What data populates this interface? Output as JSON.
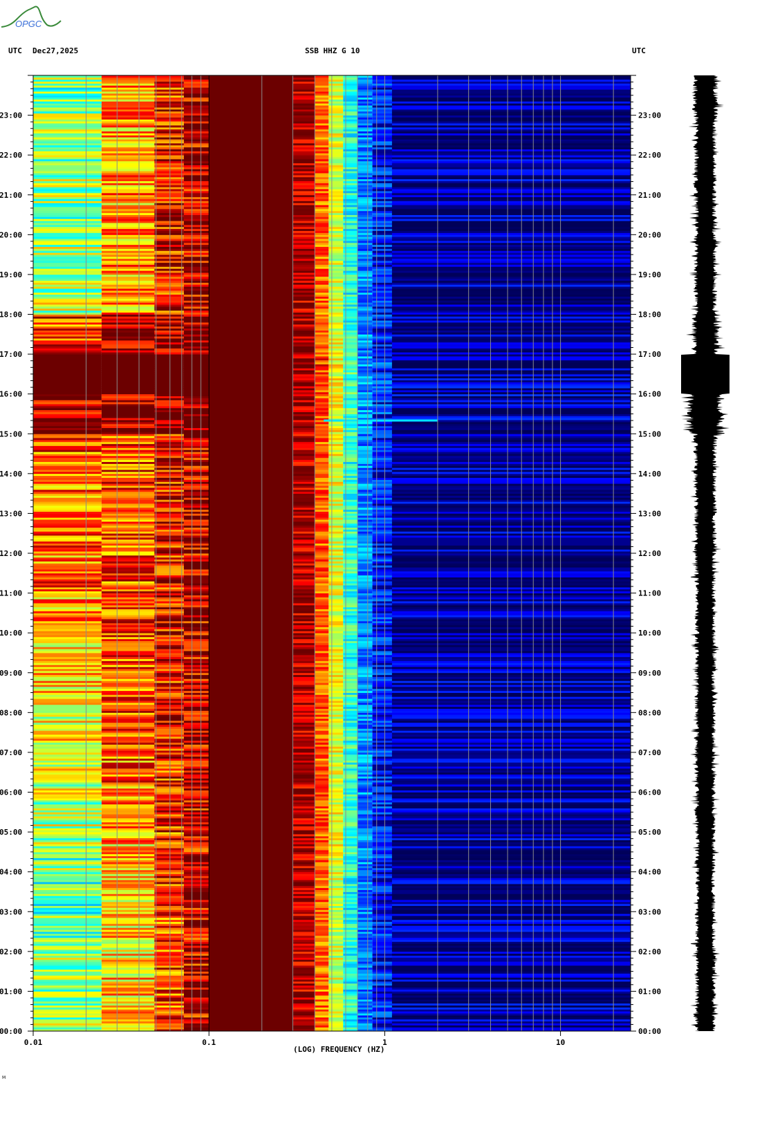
{
  "header": {
    "left_tz": "UTC",
    "date": "Dec27,2025",
    "station": "SSB HHZ G 10",
    "right_tz": "UTC"
  },
  "logo": {
    "text": "OPGC"
  },
  "footer_mark": "M",
  "colors": {
    "low": "#00008f",
    "high": "#800000",
    "grid": "#8c8c8c",
    "waveform": "#000000"
  },
  "chart_data": [
    {
      "type": "heatmap",
      "title": "SSB HHZ G 10",
      "xlabel": "(LOG) FREQUENCY (HZ)",
      "x_scale": "log",
      "xlim": [
        0.01,
        25
      ],
      "x_ticks": [
        {
          "v": 0.01,
          "label": "0.01"
        },
        {
          "v": 0.1,
          "label": "0.1"
        },
        {
          "v": 1,
          "label": "1"
        },
        {
          "v": 10,
          "label": "10"
        }
      ],
      "ylabel": "UTC",
      "ylim_hours": [
        0,
        24
      ],
      "y_ticks": [
        "00:00",
        "01:00",
        "02:00",
        "03:00",
        "04:00",
        "05:00",
        "06:00",
        "07:00",
        "08:00",
        "09:00",
        "10:00",
        "11:00",
        "12:00",
        "13:00",
        "14:00",
        "15:00",
        "16:00",
        "17:00",
        "18:00",
        "19:00",
        "20:00",
        "21:00",
        "22:00",
        "23:00"
      ],
      "grid_frequencies": [
        0.02,
        0.03,
        0.04,
        0.05,
        0.06,
        0.07,
        0.08,
        0.09,
        0.1,
        0.2,
        0.3,
        0.4,
        0.5,
        0.6,
        0.7,
        0.8,
        0.9,
        1,
        2,
        3,
        4,
        5,
        6,
        7,
        8,
        9,
        10,
        20
      ],
      "colormap": "jet",
      "value_range": [
        0,
        1
      ],
      "frequency_bands": [
        [
          0.01,
          0.0245
        ],
        [
          0.0245,
          0.049
        ],
        [
          0.049,
          0.072
        ],
        [
          0.072,
          0.1
        ],
        [
          0.1,
          0.3
        ],
        [
          0.3,
          0.4
        ],
        [
          0.4,
          0.48
        ],
        [
          0.48,
          0.58
        ],
        [
          0.58,
          0.7
        ],
        [
          0.7,
          0.85
        ],
        [
          0.85,
          1.1
        ],
        [
          1.1,
          25
        ]
      ],
      "hourly_power": [
        [
          0.5,
          0.5,
          0.48,
          0.48,
          0.5,
          0.55,
          0.6,
          0.62,
          0.65,
          0.68,
          0.72,
          0.75,
          0.76,
          0.76,
          0.78,
          0.95,
          1.0,
          0.8,
          0.55,
          0.55,
          0.52,
          0.52,
          0.5,
          0.5
        ],
        [
          0.68,
          0.68,
          0.66,
          0.68,
          0.7,
          0.74,
          0.76,
          0.76,
          0.78,
          0.78,
          0.8,
          0.8,
          0.8,
          0.8,
          0.8,
          0.97,
          1.0,
          0.98,
          0.72,
          0.72,
          0.72,
          0.74,
          0.72,
          0.72
        ],
        [
          0.8,
          0.8,
          0.8,
          0.82,
          0.82,
          0.84,
          0.84,
          0.85,
          0.85,
          0.86,
          0.86,
          0.86,
          0.87,
          0.87,
          0.87,
          0.98,
          1.0,
          0.98,
          0.86,
          0.86,
          0.85,
          0.85,
          0.84,
          0.84
        ],
        [
          0.9,
          0.9,
          0.9,
          0.9,
          0.9,
          0.91,
          0.91,
          0.92,
          0.92,
          0.92,
          0.92,
          0.92,
          0.92,
          0.93,
          0.93,
          0.98,
          1.0,
          0.98,
          0.93,
          0.93,
          0.92,
          0.92,
          0.92,
          0.92
        ],
        [
          1,
          1,
          1,
          1,
          1,
          1,
          1,
          1,
          1,
          1,
          1,
          1,
          1,
          1,
          1,
          1,
          1,
          1,
          1,
          1,
          1,
          1,
          1,
          1
        ],
        [
          0.92,
          0.92,
          0.92,
          0.92,
          0.93,
          0.93,
          0.93,
          0.93,
          0.93,
          0.93,
          0.93,
          0.93,
          0.93,
          0.93,
          0.93,
          0.95,
          0.95,
          0.94,
          0.93,
          0.93,
          0.93,
          0.93,
          0.93,
          0.93
        ],
        [
          0.76,
          0.76,
          0.76,
          0.77,
          0.77,
          0.78,
          0.78,
          0.78,
          0.78,
          0.78,
          0.78,
          0.78,
          0.78,
          0.78,
          0.78,
          0.8,
          0.8,
          0.78,
          0.77,
          0.77,
          0.77,
          0.77,
          0.76,
          0.76
        ],
        [
          0.58,
          0.58,
          0.58,
          0.58,
          0.6,
          0.6,
          0.6,
          0.6,
          0.6,
          0.6,
          0.6,
          0.6,
          0.6,
          0.6,
          0.6,
          0.62,
          0.62,
          0.6,
          0.58,
          0.58,
          0.58,
          0.58,
          0.58,
          0.58
        ],
        [
          0.4,
          0.4,
          0.4,
          0.4,
          0.42,
          0.42,
          0.42,
          0.42,
          0.42,
          0.42,
          0.42,
          0.42,
          0.42,
          0.42,
          0.42,
          0.44,
          0.44,
          0.42,
          0.4,
          0.4,
          0.4,
          0.4,
          0.4,
          0.4
        ],
        [
          0.25,
          0.25,
          0.25,
          0.25,
          0.26,
          0.26,
          0.26,
          0.26,
          0.26,
          0.26,
          0.26,
          0.26,
          0.26,
          0.26,
          0.26,
          0.28,
          0.28,
          0.26,
          0.25,
          0.25,
          0.25,
          0.25,
          0.25,
          0.25
        ],
        [
          0.16,
          0.16,
          0.16,
          0.16,
          0.16,
          0.16,
          0.16,
          0.16,
          0.16,
          0.16,
          0.16,
          0.16,
          0.16,
          0.16,
          0.16,
          0.18,
          0.18,
          0.16,
          0.16,
          0.16,
          0.16,
          0.16,
          0.16,
          0.16
        ],
        [
          0.06,
          0.06,
          0.06,
          0.06,
          0.06,
          0.06,
          0.06,
          0.06,
          0.06,
          0.06,
          0.06,
          0.06,
          0.06,
          0.06,
          0.06,
          0.07,
          0.07,
          0.06,
          0.06,
          0.06,
          0.06,
          0.06,
          0.06,
          0.06
        ]
      ],
      "events": [
        {
          "time": "15:20",
          "freq_range": [
            0.45,
            2.0
          ],
          "value": 0.35
        }
      ]
    },
    {
      "type": "line",
      "title": "waveform",
      "ylim_hours": [
        0,
        24
      ],
      "hourly_amplitude": [
        0.45,
        0.45,
        0.45,
        0.42,
        0.42,
        0.45,
        0.45,
        0.45,
        0.45,
        0.45,
        0.45,
        0.45,
        0.48,
        0.48,
        0.5,
        0.8,
        1.0,
        0.6,
        0.5,
        0.5,
        0.48,
        0.48,
        0.5,
        0.55
      ]
    }
  ]
}
